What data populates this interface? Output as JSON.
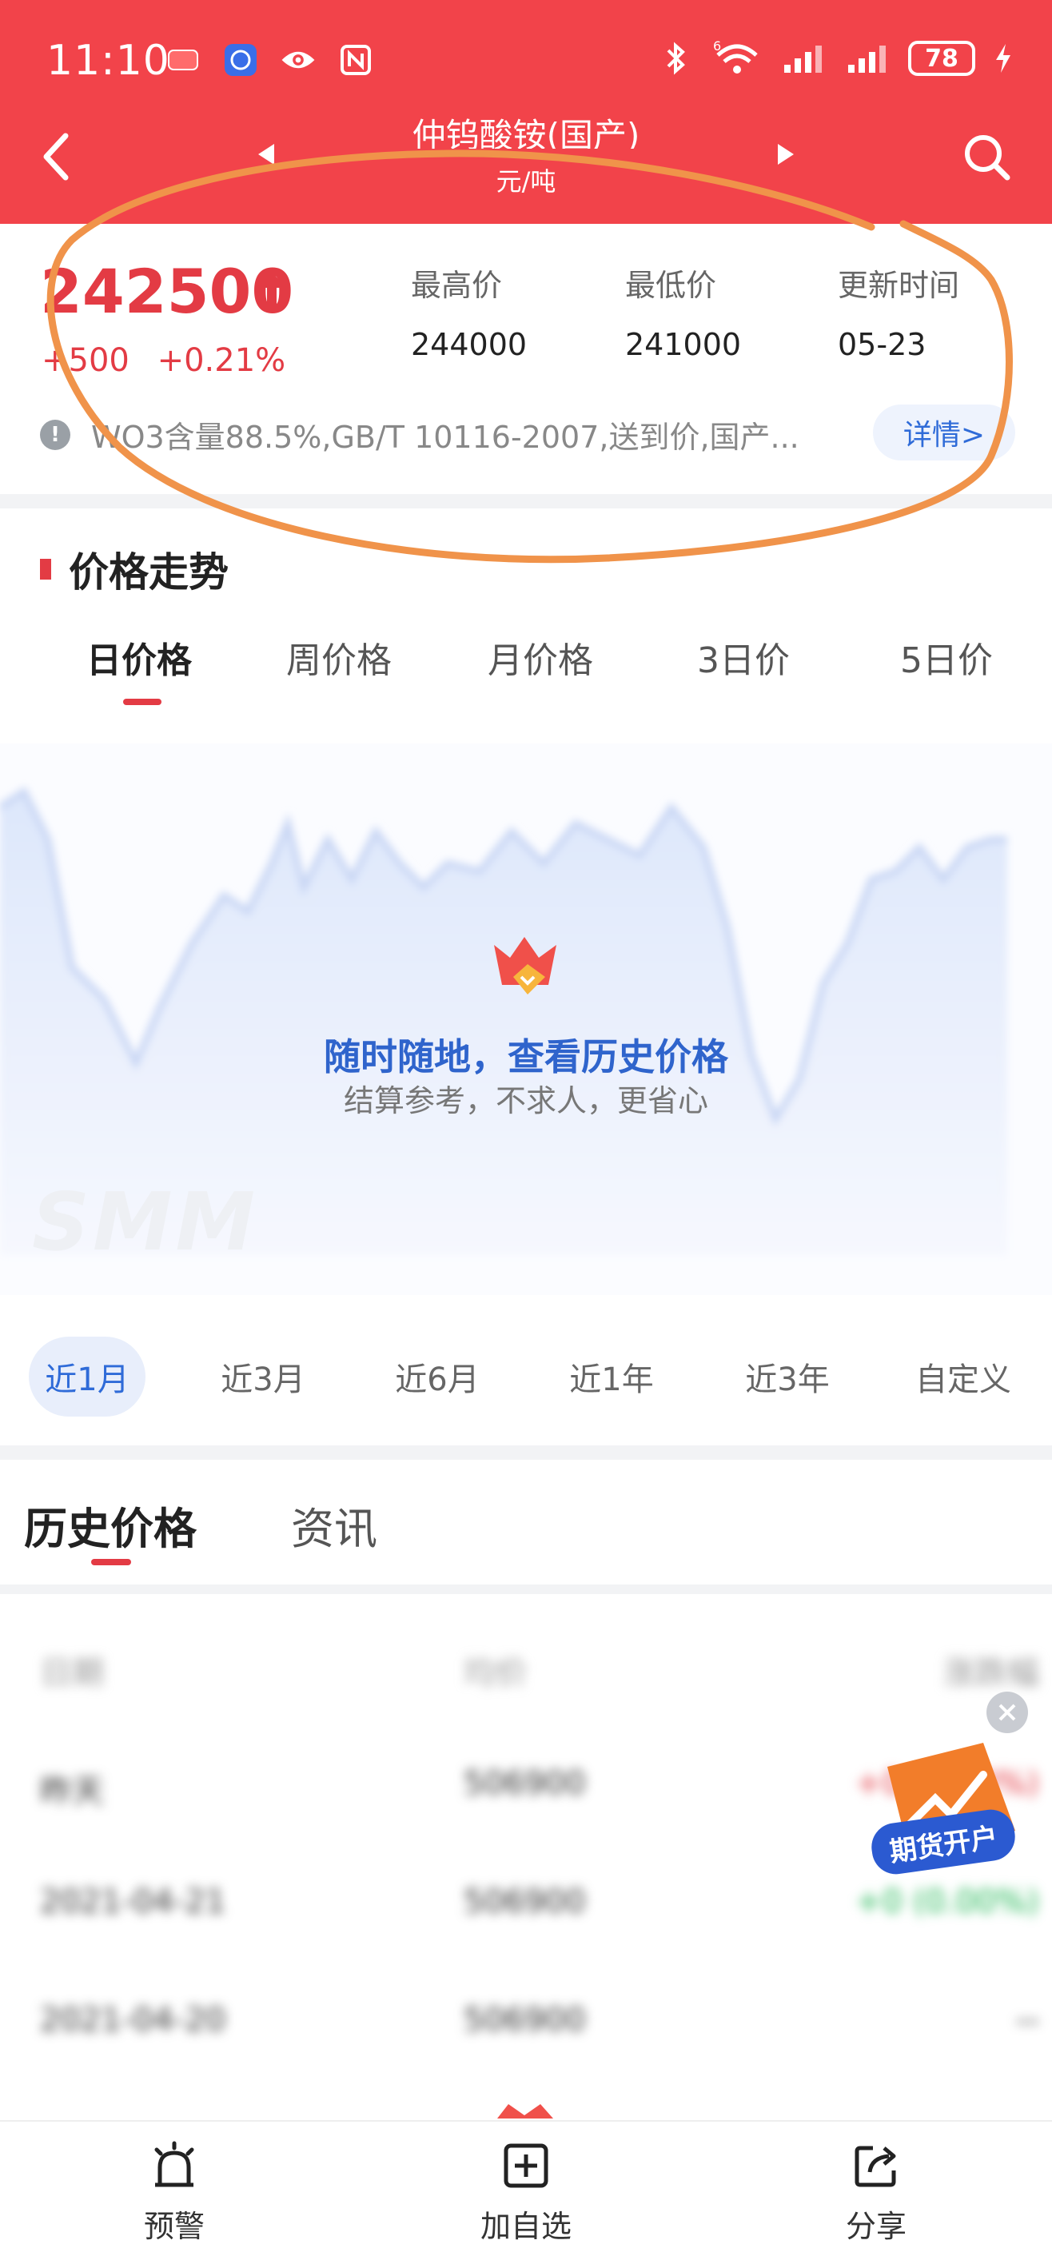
{
  "status_bar": {
    "time": "11:10",
    "battery": "78",
    "signal_label": "6"
  },
  "nav": {
    "title": "仲钨酸铵(国产)",
    "unit": "元/吨"
  },
  "quote": {
    "price": "242500",
    "change_abs": "+500",
    "change_pct": "+0.21%",
    "stats": [
      {
        "label": "最高价",
        "value": "244000"
      },
      {
        "label": "最低价",
        "value": "241000"
      },
      {
        "label": "更新时间",
        "value": "05-23"
      }
    ],
    "description": "WO3含量88.5%,GB/T 10116-2007,送到价,国产...",
    "detail_label": "详情>"
  },
  "trend": {
    "section_title": "价格走势",
    "period_tabs": [
      "日价格",
      "周价格",
      "月价格",
      "3日价",
      "5日价"
    ],
    "active_period": "日价格",
    "promo_title": "随时随地，查看历史价格",
    "promo_subtitle": "结算参考，不求人，更省心",
    "watermark": "SMM",
    "range_tabs": [
      "近1月",
      "近3月",
      "近6月",
      "近1年",
      "近3年",
      "自定义"
    ],
    "active_range": "近1月"
  },
  "history": {
    "tabs": [
      "历史价格",
      "资讯"
    ],
    "active_tab": "历史价格",
    "header": [
      "日期",
      "均价",
      "涨跌幅"
    ],
    "rows": [
      {
        "date": "昨天",
        "price": "506900",
        "change": "+0 (0.00%)"
      },
      {
        "date": "2021-04-21",
        "price": "506900",
        "change": "+0 (0.00%)"
      },
      {
        "date": "2021-04-20",
        "price": "506900",
        "change": "--"
      }
    ],
    "float_promo_label": "期货开户"
  },
  "bottom_bar": [
    {
      "label": "预警",
      "icon": "alarm-icon"
    },
    {
      "label": "加自选",
      "icon": "add-square-icon"
    },
    {
      "label": "分享",
      "icon": "share-icon"
    }
  ],
  "colors": {
    "header_bg": "#f2434a",
    "price_red": "#e33b44",
    "accent_blue": "#2f6bd8",
    "annotation_orange": "#f0934a"
  }
}
